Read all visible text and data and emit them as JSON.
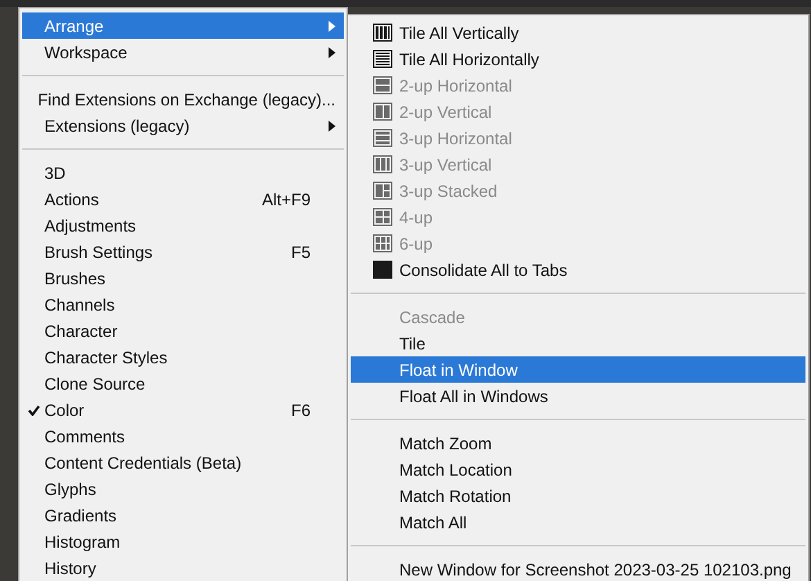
{
  "main_menu": {
    "sections": [
      [
        {
          "label": "Arrange",
          "selected": true,
          "submenu": true
        },
        {
          "label": "Workspace",
          "selected": false,
          "submenu": true
        }
      ],
      [
        {
          "label": "Find Extensions on Exchange (legacy)...",
          "selected": false
        },
        {
          "label": "Extensions (legacy)",
          "selected": false,
          "submenu": true
        }
      ],
      [
        {
          "label": "3D",
          "selected": false
        },
        {
          "label": "Actions",
          "selected": false,
          "shortcut": "Alt+F9"
        },
        {
          "label": "Adjustments",
          "selected": false
        },
        {
          "label": "Brush Settings",
          "selected": false,
          "shortcut": "F5"
        },
        {
          "label": "Brushes",
          "selected": false
        },
        {
          "label": "Channels",
          "selected": false
        },
        {
          "label": "Character",
          "selected": false
        },
        {
          "label": "Character Styles",
          "selected": false
        },
        {
          "label": "Clone Source",
          "selected": false
        },
        {
          "label": "Color",
          "selected": false,
          "checked": true,
          "shortcut": "F6"
        },
        {
          "label": "Comments",
          "selected": false
        },
        {
          "label": "Content Credentials (Beta)",
          "selected": false
        },
        {
          "label": "Glyphs",
          "selected": false
        },
        {
          "label": "Gradients",
          "selected": false
        },
        {
          "label": "Histogram",
          "selected": false
        },
        {
          "label": "History",
          "selected": false
        }
      ]
    ]
  },
  "arrange_submenu": {
    "sections": [
      [
        {
          "label": "Tile All Vertically",
          "kind": "cols4",
          "disabled": false,
          "selected": false
        },
        {
          "label": "Tile All Horizontally",
          "kind": "rows",
          "disabled": false,
          "selected": false
        },
        {
          "label": "2-up Horizontal",
          "kind": "h2",
          "disabled": true,
          "selected": false
        },
        {
          "label": "2-up Vertical",
          "kind": "v2",
          "disabled": true,
          "selected": false
        },
        {
          "label": "3-up Horizontal",
          "kind": "h3",
          "disabled": true,
          "selected": false
        },
        {
          "label": "3-up Vertical",
          "kind": "v3",
          "disabled": true,
          "selected": false
        },
        {
          "label": "3-up Stacked",
          "kind": "stacked",
          "disabled": true,
          "selected": false
        },
        {
          "label": "4-up",
          "kind": "grid4",
          "disabled": true,
          "selected": false
        },
        {
          "label": "6-up",
          "kind": "grid6",
          "disabled": true,
          "selected": false
        },
        {
          "label": "Consolidate All to Tabs",
          "kind": "single",
          "disabled": false,
          "selected": false
        }
      ],
      [
        {
          "label": "Cascade",
          "disabled": true,
          "selected": false
        },
        {
          "label": "Tile",
          "disabled": false,
          "selected": false
        },
        {
          "label": "Float in Window",
          "disabled": false,
          "selected": true
        },
        {
          "label": "Float All in Windows",
          "disabled": false,
          "selected": false
        }
      ],
      [
        {
          "label": "Match Zoom",
          "disabled": false,
          "selected": false
        },
        {
          "label": "Match Location",
          "disabled": false,
          "selected": false
        },
        {
          "label": "Match Rotation",
          "disabled": false,
          "selected": false
        },
        {
          "label": "Match All",
          "disabled": false,
          "selected": false
        }
      ],
      [
        {
          "label": "New Window for Screenshot 2023-03-25 102103.png",
          "disabled": false,
          "selected": false
        }
      ]
    ]
  }
}
